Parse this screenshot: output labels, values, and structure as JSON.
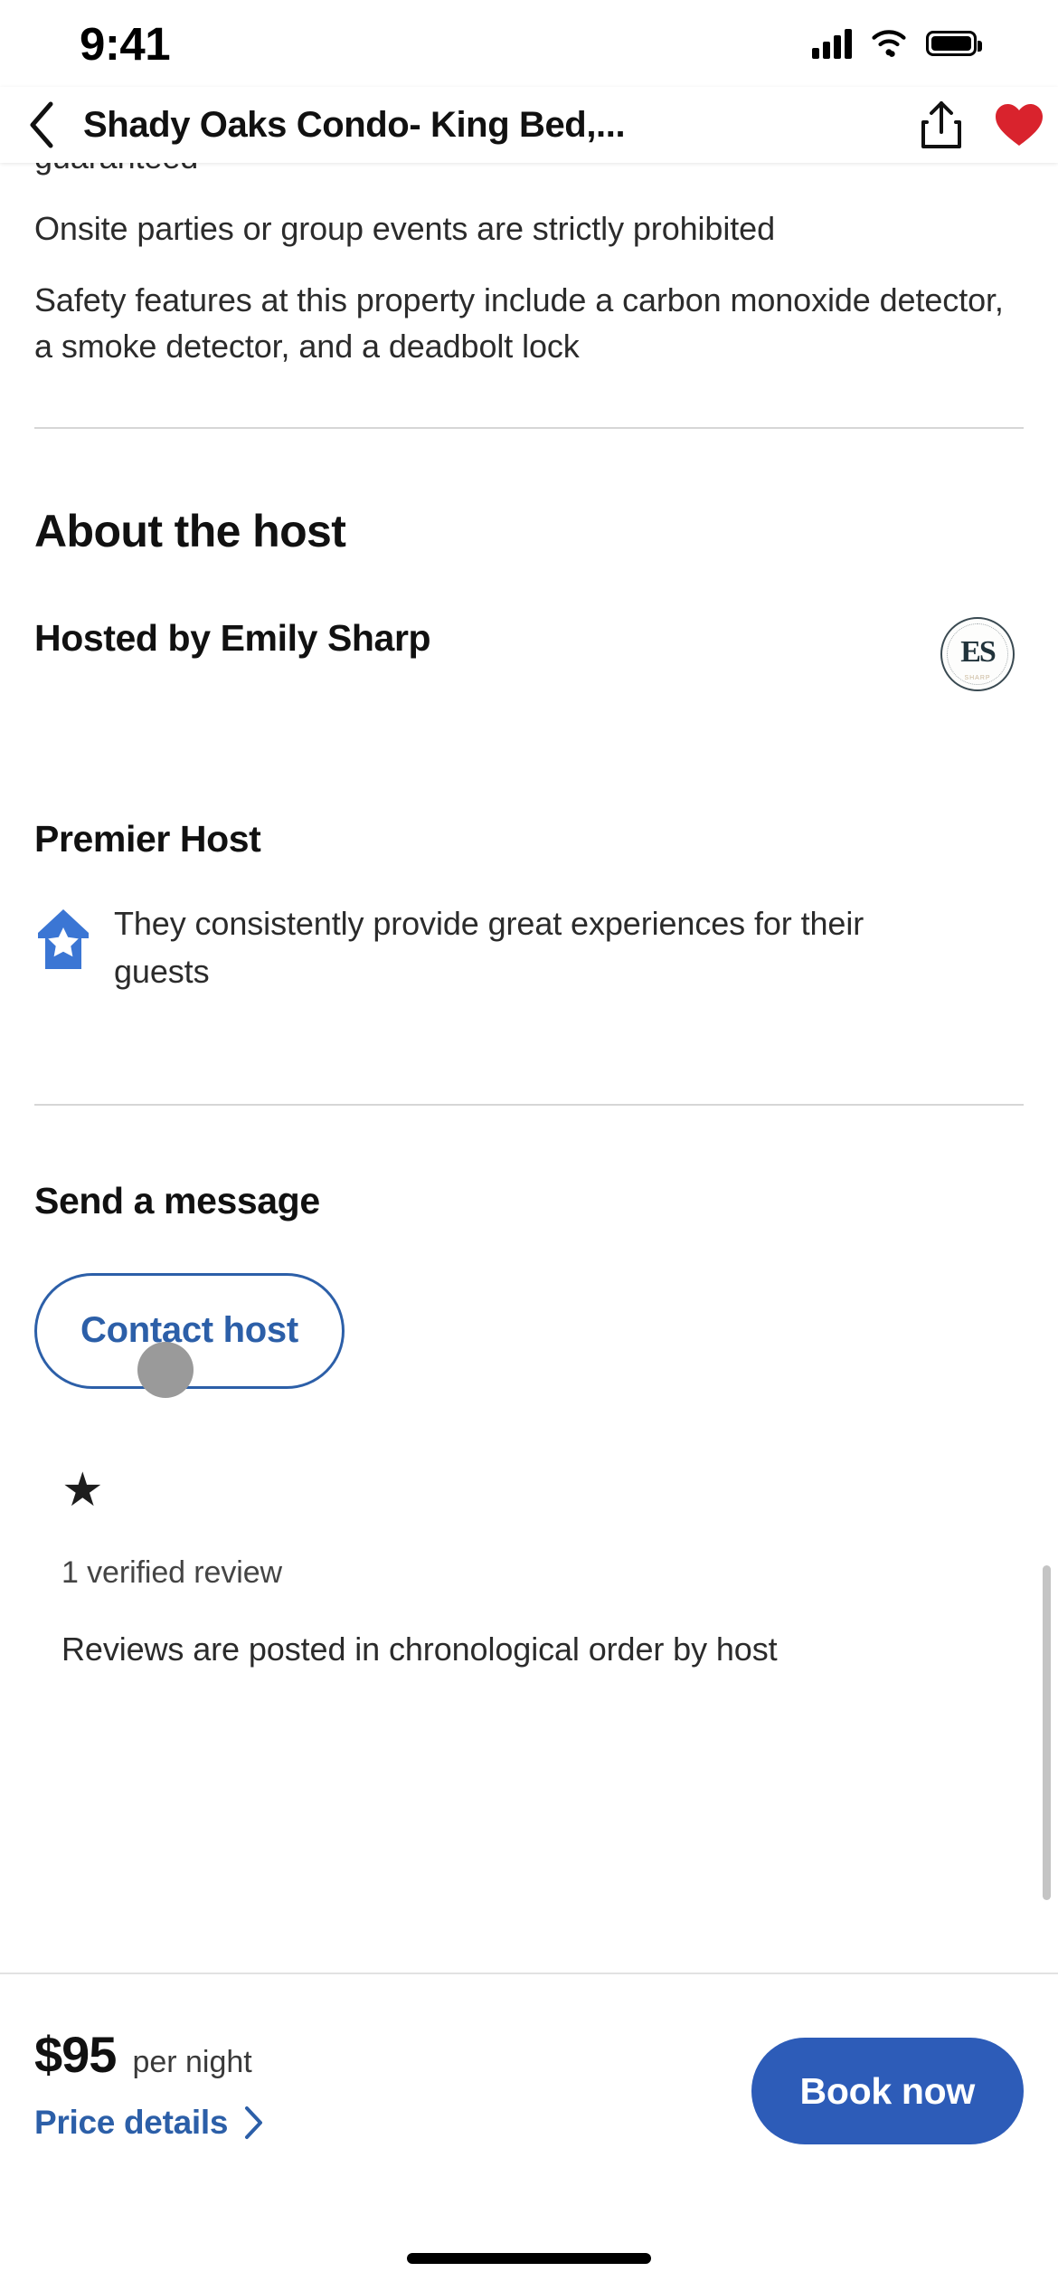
{
  "status_bar": {
    "time": "9:41",
    "cellular_icon": "cellular-bars-icon",
    "wifi_icon": "wifi-icon",
    "battery_icon": "battery-full-icon"
  },
  "nav_bar": {
    "back_icon": "chevron-left-icon",
    "title": "Shady Oaks Condo- King Bed,...",
    "share_icon": "share-icon",
    "favorite_icon": "heart-filled-icon",
    "favorite_color": "#d9232d"
  },
  "house_rules": {
    "cut_off_line": "guaranteed",
    "lines": [
      "Onsite parties or group events are strictly prohibited",
      "Safety features at this property include a carbon monoxide detector, a smoke detector, and a deadbolt lock"
    ]
  },
  "about_host": {
    "section_title": "About the host",
    "hosted_by": "Hosted by Emily Sharp",
    "avatar": {
      "name": "host-avatar",
      "monogram": "ES",
      "ring_text": "EXPERIENCES EMILY",
      "sub_text": "SHARP"
    }
  },
  "premier_host": {
    "title": "Premier Host",
    "badge_icon": "house-star-badge-icon",
    "badge_color": "#3b76d4",
    "description": "They consistently provide great experiences for their guests"
  },
  "send_message": {
    "title": "Send a message",
    "contact_button": "Contact host",
    "button_color": "#2c5fa8"
  },
  "reviews": {
    "star_icon": "star-filled-icon",
    "count_label": "1 verified review",
    "cut_off_line": "Reviews are posted in chronological order by host"
  },
  "bottom_bar": {
    "price_amount": "$95",
    "price_unit": "per night",
    "price_details_label": "Price details",
    "price_details_icon": "chevron-right-icon",
    "book_button": "Book now",
    "book_button_color": "#2d5cb8"
  },
  "scrollbar": {
    "name": "vertical-scrollbar"
  },
  "home_indicator": {
    "name": "home-indicator"
  }
}
